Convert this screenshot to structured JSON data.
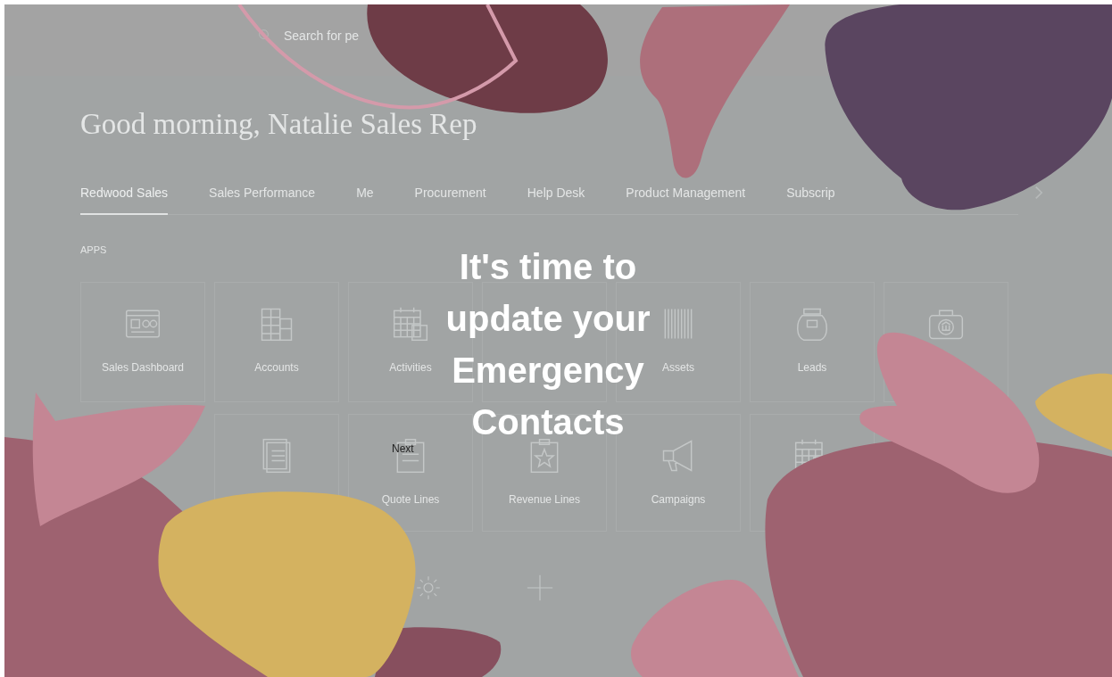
{
  "top_bar": {
    "search": {
      "placeholder": "Search for pe"
    }
  },
  "greeting": "Good morning, Natalie Sales Rep",
  "tabs": [
    {
      "label": "Redwood Sales",
      "selected": true
    },
    {
      "label": "Sales Performance",
      "selected": false
    },
    {
      "label": "Me",
      "selected": false
    },
    {
      "label": "Procurement",
      "selected": false
    },
    {
      "label": "Help Desk",
      "selected": false
    },
    {
      "label": "Product Management",
      "selected": false
    },
    {
      "label": "Subscrip",
      "selected": false
    }
  ],
  "apps": {
    "heading": "APPS",
    "rows": [
      [
        {
          "kind": "tile",
          "label": "Sales Dashboard"
        },
        {
          "kind": "tile",
          "label": "Accounts"
        },
        {
          "kind": "tile",
          "label": "Activities"
        },
        {
          "kind": "tile"
        },
        {
          "kind": "tile",
          "label": "Assets"
        },
        {
          "kind": "tile",
          "label": "Leads"
        },
        {
          "kind": "tile"
        }
      ],
      [
        {
          "kind": "blank"
        },
        {
          "kind": "tile"
        },
        {
          "kind": "tile",
          "label": "Quote Lines"
        },
        {
          "kind": "tile",
          "label": "Revenue Lines"
        },
        {
          "kind": "tile",
          "label": "Campaigns"
        },
        {
          "kind": "tile"
        }
      ],
      [
        {
          "kind": "blank"
        },
        {
          "kind": "blank"
        },
        {
          "kind": "action"
        },
        {
          "kind": "action"
        }
      ]
    ]
  },
  "overlay": {
    "title": "It's time to update your Emergency Contacts",
    "next": "Next"
  }
}
